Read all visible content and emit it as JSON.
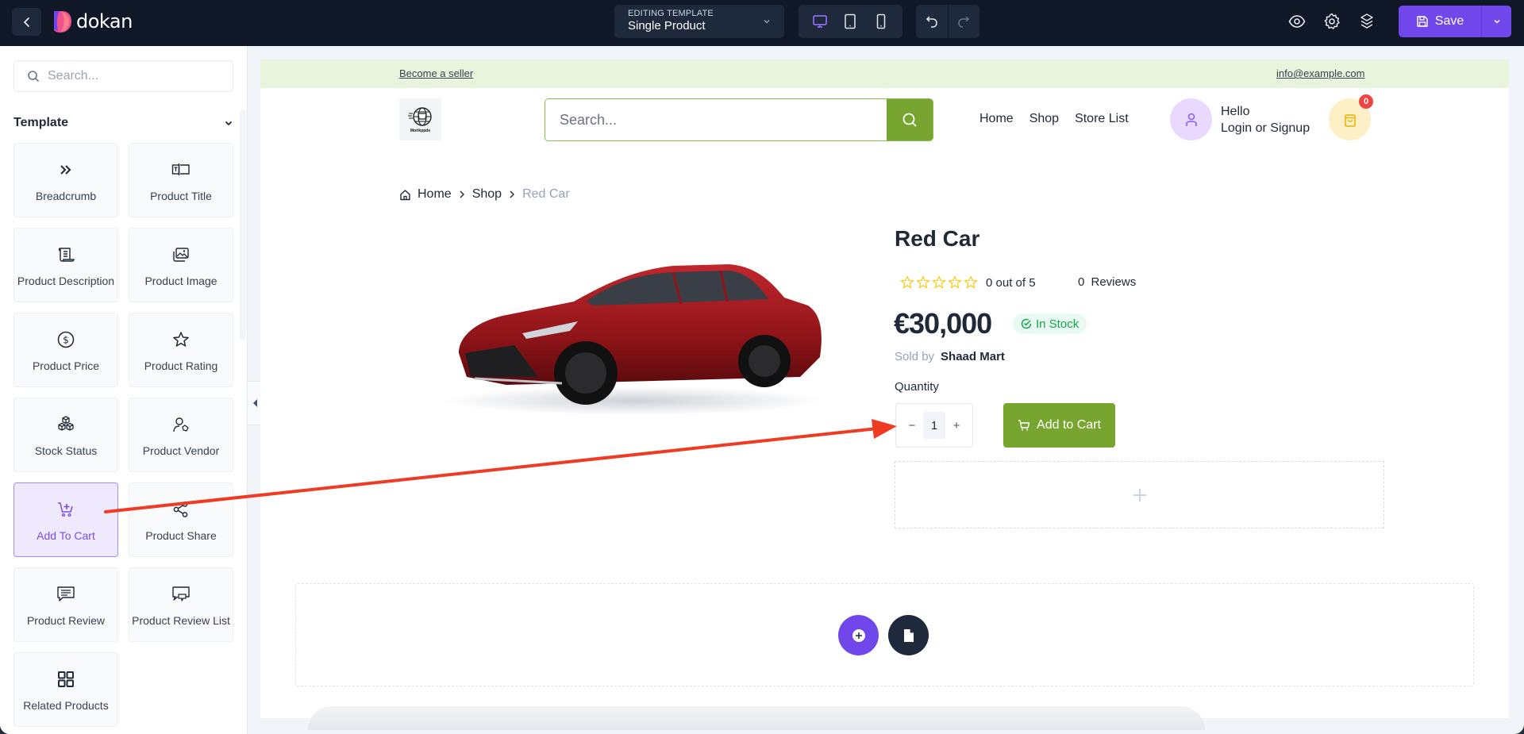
{
  "topbar": {
    "brand": "dokan",
    "template_label": "EDITING TEMPLATE",
    "template_value": "Single Product",
    "save_label": "Save",
    "devices": [
      "desktop",
      "tablet",
      "mobile"
    ],
    "active_device": "desktop",
    "accent_color": "#7047eb"
  },
  "sidebar": {
    "search_placeholder": "Search...",
    "section_title": "Template",
    "widgets": [
      {
        "label": "Breadcrumb",
        "icon": "double-chevron-right-icon"
      },
      {
        "label": "Product Title",
        "icon": "title-field-icon"
      },
      {
        "label": "Product Description",
        "icon": "scroll-text-icon"
      },
      {
        "label": "Product Image",
        "icon": "images-icon"
      },
      {
        "label": "Product Price",
        "icon": "dollar-circle-icon"
      },
      {
        "label": "Product Rating",
        "icon": "star-icon"
      },
      {
        "label": "Stock Status",
        "icon": "boxes-icon"
      },
      {
        "label": "Product Vendor",
        "icon": "user-tag-icon"
      },
      {
        "label": "Add To Cart",
        "icon": "cart-plus-icon",
        "active": true
      },
      {
        "label": "Product Share",
        "icon": "share-icon"
      },
      {
        "label": "Product Review",
        "icon": "message-icon"
      },
      {
        "label": "Product Review List",
        "icon": "messages-icon"
      },
      {
        "label": "Related Products",
        "icon": "grid-icon"
      }
    ]
  },
  "store": {
    "become_seller": "Become a seller",
    "email": "info@example.com",
    "logo_text": "Morikppde",
    "search_placeholder": "Search...",
    "nav": [
      "Home",
      "Shop",
      "Store List"
    ],
    "greeting": "Hello",
    "login": "Login or Signup",
    "cart_count": "0",
    "brand_green": "#78a52f"
  },
  "product": {
    "breadcrumb": [
      "Home",
      "Shop",
      "Red Car"
    ],
    "title": "Red Car",
    "rating_text": "0 out of 5",
    "rating_value": 0,
    "rating_max": 5,
    "reviews": "0 Reviews",
    "price": "€30,000",
    "stock": "In Stock",
    "sold_by_label": "Sold by",
    "vendor": "Shaad Mart",
    "quantity_label": "Quantity",
    "quantity": "1",
    "add_to_cart": "Add to Cart"
  },
  "annotation": {
    "arrow_color": "#ef3b24"
  }
}
